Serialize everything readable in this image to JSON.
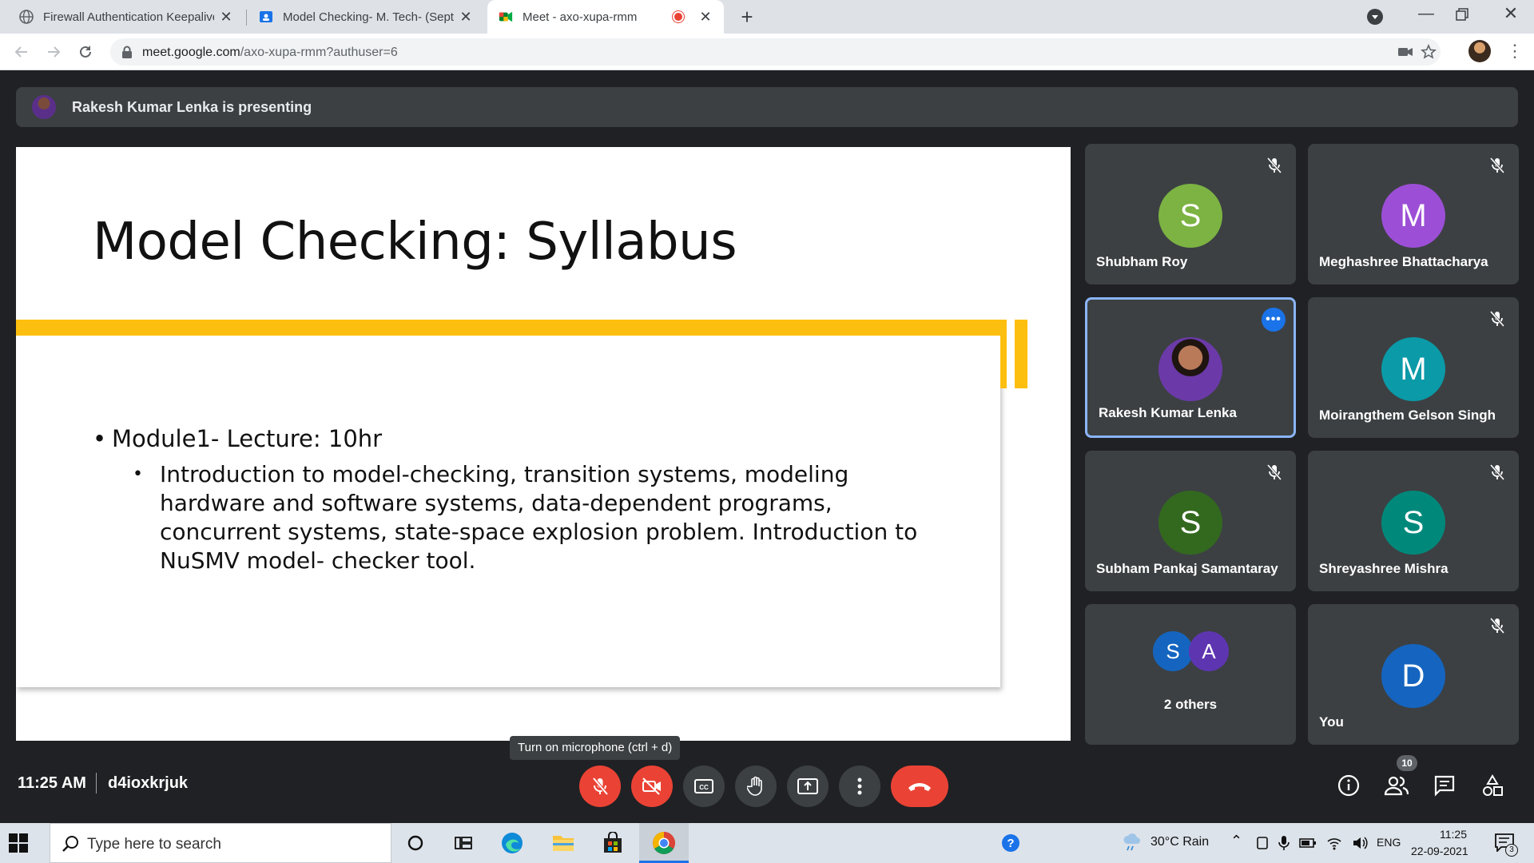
{
  "browser": {
    "tabs": [
      {
        "title": "Firewall Authentication Keepalive",
        "favicon": "globe-icon",
        "active": false
      },
      {
        "title": "Model Checking- M. Tech- (Sept-",
        "favicon": "classroom-icon",
        "active": false
      },
      {
        "title": "Meet - axo-xupa-rmm",
        "favicon": "meet-icon",
        "active": true
      }
    ],
    "url_host": "meet.google.com",
    "url_path": "/axo-xupa-rmm?authuser=6"
  },
  "meet": {
    "presenting_text": "Rakesh Kumar Lenka is presenting",
    "slide": {
      "title": "Model Checking: Syllabus",
      "bullet": "Module1- Lecture: 10hr",
      "sub_bullet": "Introduction to model-checking, transition systems, modeling hardware and software systems, data-dependent programs, concurrent systems, state-space explosion problem. Introduction to NuSMV model- checker tool."
    },
    "participants": [
      {
        "name": "Shubham Roy",
        "initial": "S",
        "color": "#7cb342",
        "muted": true
      },
      {
        "name": "Meghashree Bhattacharya",
        "initial": "M",
        "color": "#9c4fd6",
        "muted": true
      },
      {
        "name": "Rakesh Kumar Lenka",
        "initial": "",
        "color": "#6b3a2e",
        "muted": false,
        "presenting": true
      },
      {
        "name": "Moirangthem Gelson Singh",
        "initial": "M",
        "color": "#0b9aa8",
        "muted": true
      },
      {
        "name": "Subham Pankaj Samantaray",
        "initial": "S",
        "color": "#33691e",
        "muted": true
      },
      {
        "name": "Shreyashree Mishra",
        "initial": "S",
        "color": "#00897b",
        "muted": true
      },
      {
        "name": "2 others",
        "initials": [
          "S",
          "A"
        ],
        "colors": [
          "#1565c0",
          "#5e35b1"
        ]
      },
      {
        "name": "You",
        "initial": "D",
        "color": "#1565c0",
        "muted": true
      }
    ],
    "time": "11:25 AM",
    "meeting_code": "d4ioxkrjuk",
    "tooltip": "Turn on microphone (ctrl + d)",
    "people_count": "10"
  },
  "taskbar": {
    "search_placeholder": "Type here to search",
    "weather": "30°C  Rain",
    "language": "ENG",
    "time": "11:25",
    "date": "22-09-2021",
    "notification_count": "3"
  }
}
